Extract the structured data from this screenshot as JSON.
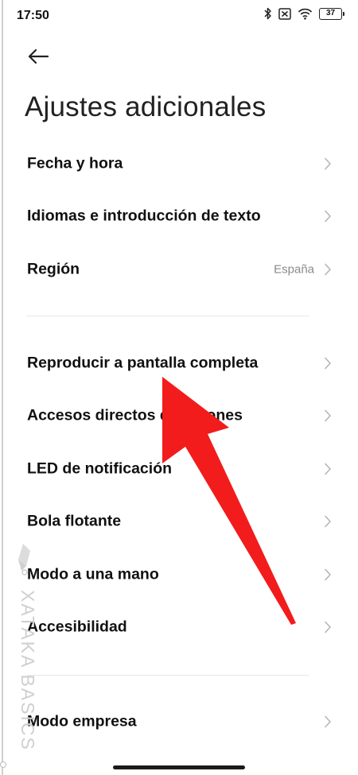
{
  "status_bar": {
    "time": "17:50",
    "battery": "37",
    "icons": [
      "bluetooth-icon",
      "sim-off-icon",
      "wifi-icon",
      "battery-icon"
    ]
  },
  "header": {
    "back_icon": "arrow-left-icon",
    "title": "Ajustes adicionales"
  },
  "settings": {
    "group1": [
      {
        "label": "Fecha y hora",
        "value": ""
      },
      {
        "label": "Idiomas e introducción de texto",
        "value": ""
      },
      {
        "label": "Región",
        "value": "España"
      }
    ],
    "group2": [
      {
        "label": "Reproducir a pantalla completa",
        "value": ""
      },
      {
        "label": "Accesos directos de botones",
        "value": ""
      },
      {
        "label": "LED de notificación",
        "value": ""
      },
      {
        "label": "Bola flotante",
        "value": ""
      },
      {
        "label": "Modo a una mano",
        "value": ""
      },
      {
        "label": "Accesibilidad",
        "value": ""
      }
    ],
    "group3": [
      {
        "label": "Modo empresa",
        "value": ""
      }
    ]
  },
  "overlay": {
    "arrow_color": "#f21c1c",
    "arrow_icon": "red-pointer-arrow-icon"
  },
  "watermark": {
    "text": "XATAKA BASICS",
    "logo_icon": "xataka-logo-icon"
  },
  "colors": {
    "text": "#111111",
    "secondary_text": "#8a8a8a",
    "divider": "#e6e6e6",
    "chevron": "#b5b5b5"
  }
}
